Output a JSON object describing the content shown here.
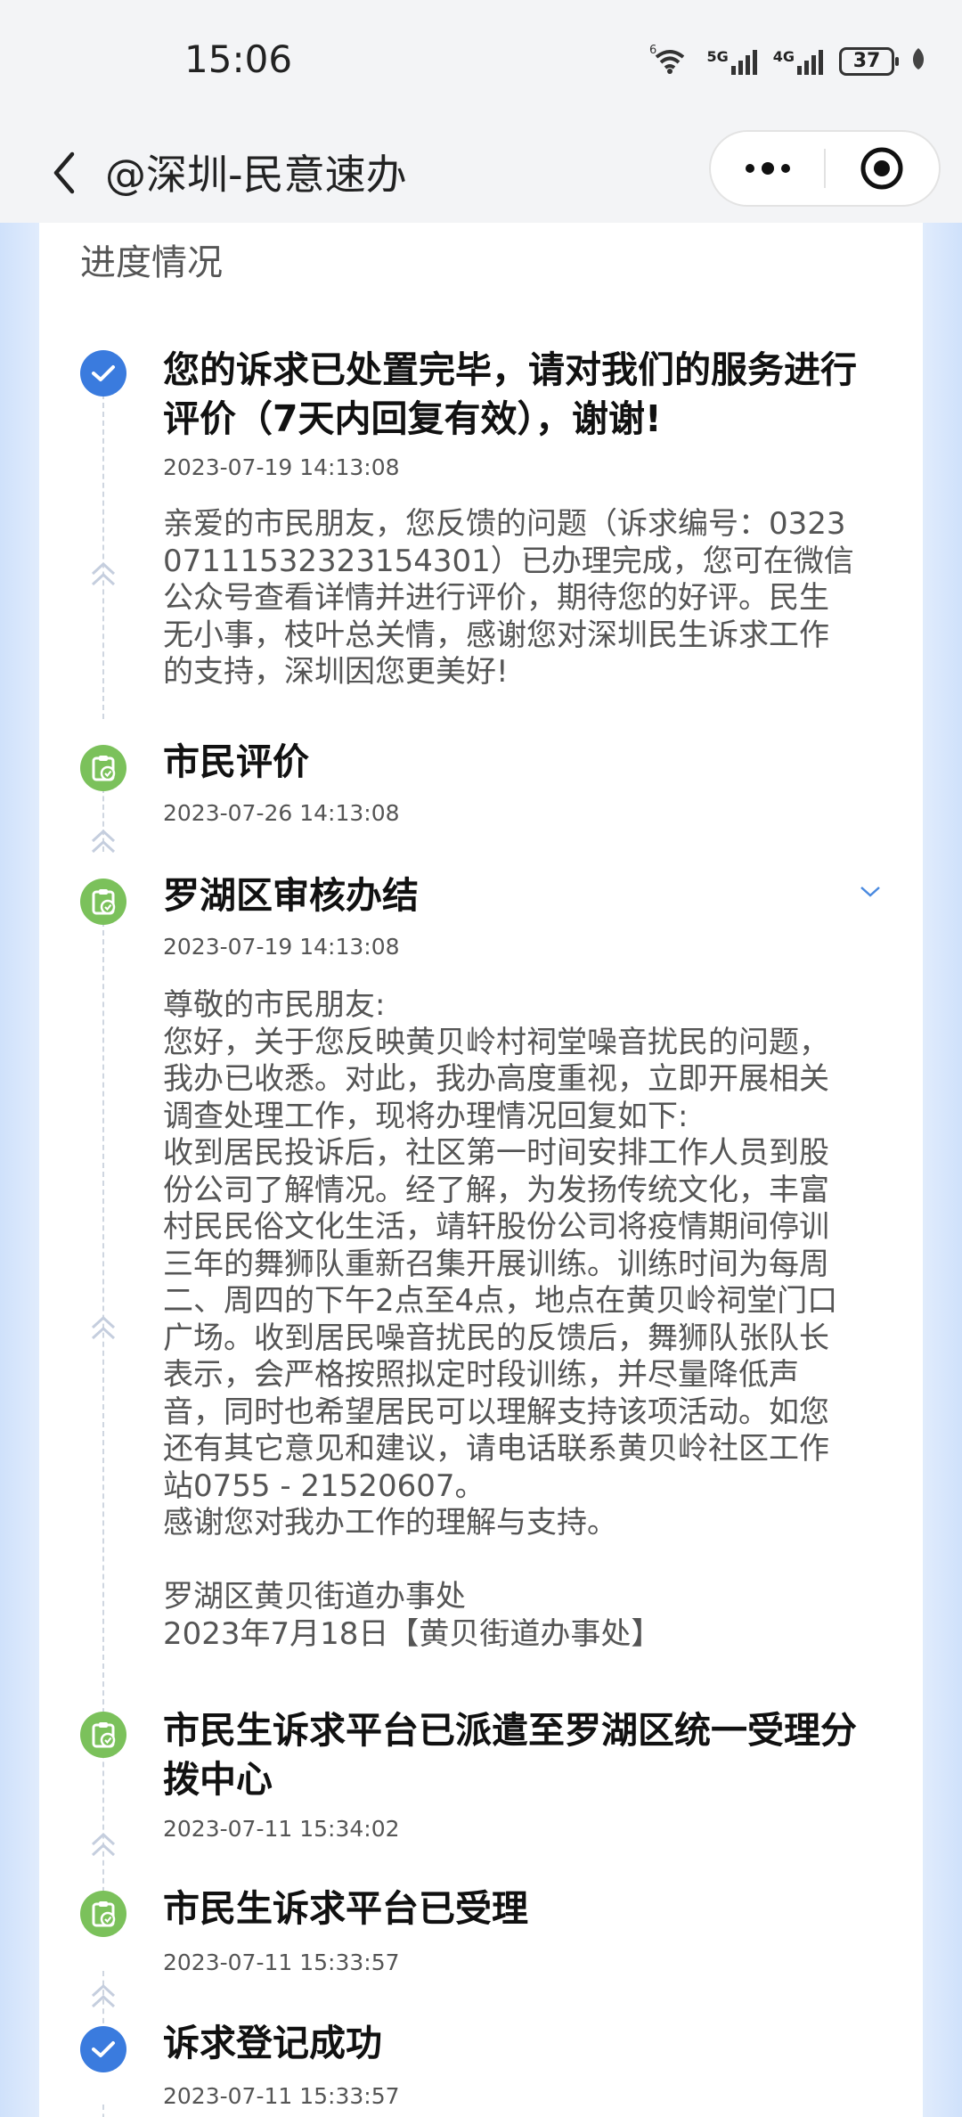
{
  "status_bar": {
    "time": "15:06",
    "net1": "6",
    "net2": "5G",
    "net3": "4G",
    "battery": "37"
  },
  "nav": {
    "title": "@深圳-民意速办"
  },
  "card": {
    "title": "进度情况"
  },
  "timeline": [
    {
      "title": "您的诉求已处置完毕，请对我们的服务进行评价（7天内回复有效），谢谢!",
      "time": "2023-07-19 14:13:08",
      "body": "亲爱的市民朋友，您反馈的问题（诉求编号：0323\n07111532323154301）已办理完成，您可在微信\n公众号查看详情并进行评价，期待您的好评。民生\n无小事，枝叶总关情，感谢您对深圳民生诉求工作\n的支持，深圳因您更美好!",
      "icon": "check-circle-icon"
    },
    {
      "title": "市民评价",
      "time": "2023-07-26 14:13:08",
      "body": "",
      "icon": "clipboard-check-icon"
    },
    {
      "title": "罗湖区审核办结",
      "time": "2023-07-19 14:13:08",
      "body": "尊敬的市民朋友:\n您好，关于您反映黄贝岭村祠堂噪音扰民的问题，\n我办已收悉。对此，我办高度重视，立即开展相关\n调查处理工作，现将办理情况回复如下:\n收到居民投诉后，社区第一时间安排工作人员到股\n份公司了解情况。经了解，为发扬传统文化，丰富\n村民民俗文化生活，靖轩股份公司将疫情期间停训\n三年的舞狮队重新召集开展训练。训练时间为每周\n二、周四的下午2点至4点，地点在黄贝岭祠堂门口\n广场。收到居民噪音扰民的反馈后，舞狮队张队长\n表示，会严格按照拟定时段训练，并尽量降低声\n音，同时也希望居民可以理解支持该项活动。如您\n还有其它意见和建议，请电话联系黄贝岭社区工作\n站0755 - 21520607。\n感谢您对我办工作的理解与支持。\n\n罗湖区黄贝街道办事处\n2023年7月18日【黄贝街道办事处】",
      "icon": "clipboard-check-icon"
    },
    {
      "title": "市民生诉求平台已派遣至罗湖区统一受理分拨中心",
      "time": "2023-07-11 15:34:02",
      "body": "",
      "icon": "clipboard-check-icon"
    },
    {
      "title": "市民生诉求平台已受理",
      "time": "2023-07-11 15:33:57",
      "body": "",
      "icon": "clipboard-check-icon"
    },
    {
      "title": "诉求登记成功",
      "time": "2023-07-11 15:33:57",
      "body": "",
      "icon": "check-circle-icon"
    }
  ],
  "colors": {
    "blue": "#3a7bde",
    "green": "#7bc15b"
  }
}
